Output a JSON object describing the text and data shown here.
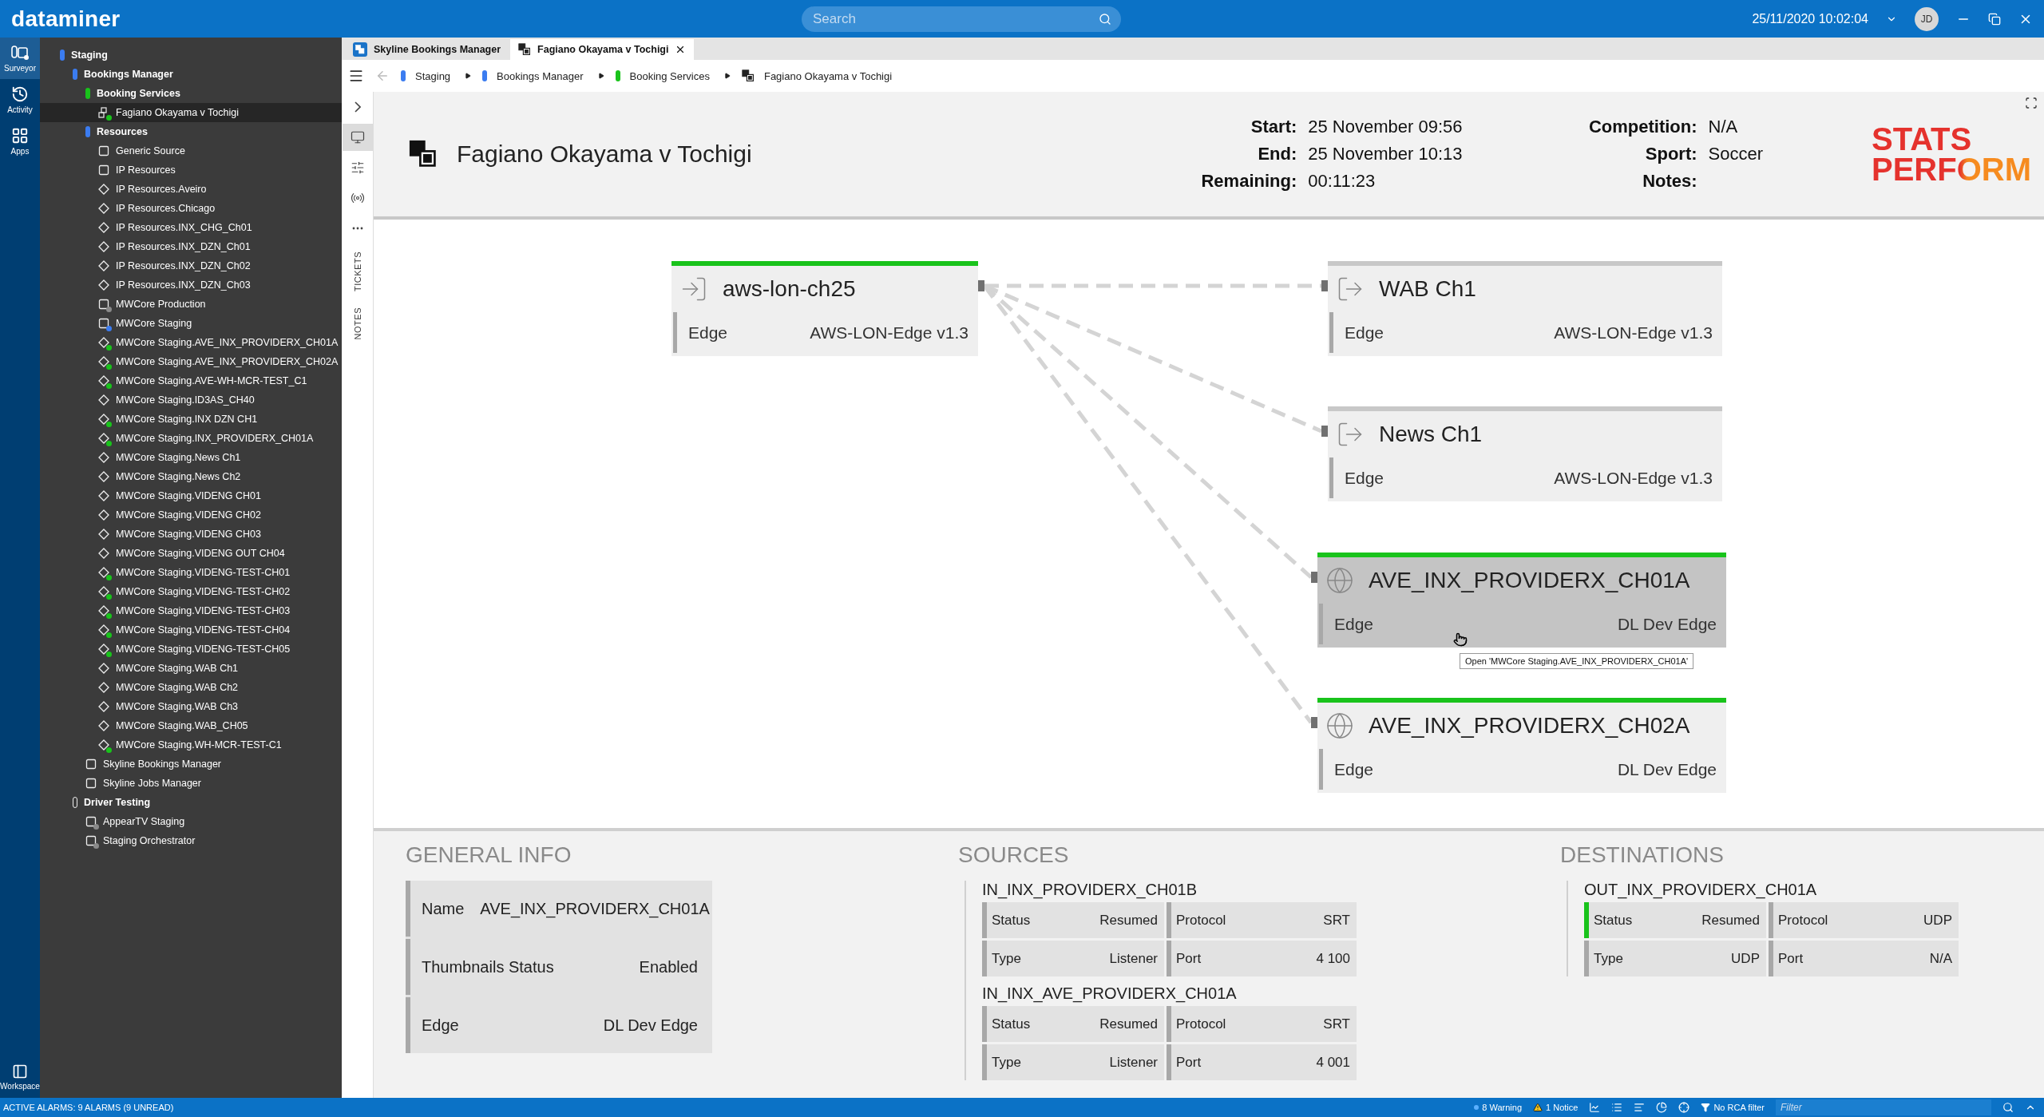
{
  "app": {
    "logo": "dataminer",
    "search_placeholder": "Search",
    "datetime": "25/11/2020 10:02:04",
    "user_initials": "JD"
  },
  "rail": {
    "items": [
      {
        "label": "Surveyor",
        "selected": true
      },
      {
        "label": "Activity",
        "selected": false
      },
      {
        "label": "Apps",
        "selected": false
      }
    ],
    "bottom_label": "Workspace"
  },
  "tree": [
    {
      "label": "Staging",
      "kind": "view",
      "color": "#3b7cf0",
      "selected": false,
      "children": [
        {
          "label": "Bookings Manager",
          "kind": "view",
          "color": "#3b7cf0",
          "selected": false,
          "children": [
            {
              "label": "Booking Services",
              "kind": "view",
              "color": "#19c31b",
              "selected": false,
              "children": [
                {
                  "label": "Fagiano Okayama v Tochigi",
                  "kind": "booking",
                  "color": "#19c31b",
                  "selected": true
                }
              ]
            },
            {
              "label": "Resources",
              "kind": "view",
              "color": "#3b7cf0",
              "selected": false,
              "children": [
                {
                  "label": "Generic Source",
                  "kind": "element",
                  "selected": false
                },
                {
                  "label": "IP Resources",
                  "kind": "element",
                  "selected": false
                },
                {
                  "label": "IP Resources.Aveiro",
                  "kind": "service",
                  "selected": false
                },
                {
                  "label": "IP Resources.Chicago",
                  "kind": "service",
                  "selected": false
                },
                {
                  "label": "IP Resources.INX_CHG_Ch01",
                  "kind": "service",
                  "selected": false
                },
                {
                  "label": "IP Resources.INX_DZN_Ch01",
                  "kind": "service",
                  "selected": false
                },
                {
                  "label": "IP Resources.INX_DZN_Ch02",
                  "kind": "service",
                  "selected": false
                },
                {
                  "label": "IP Resources.INX_DZN_Ch03",
                  "kind": "service",
                  "selected": false
                },
                {
                  "label": "MWCore Production",
                  "kind": "element",
                  "color": "#8a8a8a",
                  "selected": false
                },
                {
                  "label": "MWCore Staging",
                  "kind": "element",
                  "color": "#3b7cf0",
                  "selected": false
                },
                {
                  "label": "MWCore Staging.AVE_INX_PROVIDERX_CH01A",
                  "kind": "service",
                  "color": "#19c31b",
                  "selected": false
                },
                {
                  "label": "MWCore Staging.AVE_INX_PROVIDERX_CH02A",
                  "kind": "service",
                  "color": "#19c31b",
                  "selected": false
                },
                {
                  "label": "MWCore Staging.AVE-WH-MCR-TEST_C1",
                  "kind": "service",
                  "color": "#19c31b",
                  "selected": false
                },
                {
                  "label": "MWCore Staging.ID3AS_CH40",
                  "kind": "service",
                  "selected": false
                },
                {
                  "label": "MWCore Staging.INX DZN CH1",
                  "kind": "service",
                  "color": "#19c31b",
                  "selected": false
                },
                {
                  "label": "MWCore Staging.INX_PROVIDERX_CH01A",
                  "kind": "service",
                  "color": "#19c31b",
                  "selected": false
                },
                {
                  "label": "MWCore Staging.News Ch1",
                  "kind": "service",
                  "selected": false
                },
                {
                  "label": "MWCore Staging.News Ch2",
                  "kind": "service",
                  "selected": false
                },
                {
                  "label": "MWCore Staging.VIDENG CH01",
                  "kind": "service",
                  "selected": false
                },
                {
                  "label": "MWCore Staging.VIDENG CH02",
                  "kind": "service",
                  "selected": false
                },
                {
                  "label": "MWCore Staging.VIDENG CH03",
                  "kind": "service",
                  "selected": false
                },
                {
                  "label": "MWCore Staging.VIDENG OUT CH04",
                  "kind": "service",
                  "selected": false
                },
                {
                  "label": "MWCore Staging.VIDENG-TEST-CH01",
                  "kind": "service",
                  "color": "#19c31b",
                  "selected": false
                },
                {
                  "label": "MWCore Staging.VIDENG-TEST-CH02",
                  "kind": "service",
                  "color": "#19c31b",
                  "selected": false
                },
                {
                  "label": "MWCore Staging.VIDENG-TEST-CH03",
                  "kind": "service",
                  "color": "#19c31b",
                  "selected": false
                },
                {
                  "label": "MWCore Staging.VIDENG-TEST-CH04",
                  "kind": "service",
                  "color": "#19c31b",
                  "selected": false
                },
                {
                  "label": "MWCore Staging.VIDENG-TEST-CH05",
                  "kind": "service",
                  "color": "#19c31b",
                  "selected": false
                },
                {
                  "label": "MWCore Staging.WAB Ch1",
                  "kind": "service",
                  "selected": false
                },
                {
                  "label": "MWCore Staging.WAB Ch2",
                  "kind": "service",
                  "selected": false
                },
                {
                  "label": "MWCore Staging.WAB Ch3",
                  "kind": "service",
                  "selected": false
                },
                {
                  "label": "MWCore Staging.WAB_CH05",
                  "kind": "service",
                  "selected": false
                },
                {
                  "label": "MWCore Staging.WH-MCR-TEST-C1",
                  "kind": "service",
                  "color": "#19c31b",
                  "selected": false
                }
              ]
            },
            {
              "label": "Skyline Bookings Manager",
              "kind": "element",
              "selected": false
            },
            {
              "label": "Skyline Jobs Manager",
              "kind": "element",
              "selected": false
            }
          ]
        },
        {
          "label": "Driver Testing",
          "kind": "view",
          "selected": false,
          "children": [
            {
              "label": "AppearTV Staging",
              "kind": "element",
              "color": "#8a8a8a",
              "selected": false
            },
            {
              "label": "Staging Orchestrator",
              "kind": "element",
              "color": "#8a8a8a",
              "selected": false
            }
          ]
        }
      ]
    }
  ],
  "tabs": [
    {
      "label": "Skyline Bookings Manager",
      "kind": "app",
      "selected": false
    },
    {
      "label": "Fagiano Okayama v Tochigi",
      "kind": "booking",
      "selected": true
    }
  ],
  "breadcrumb": [
    {
      "label": "Staging",
      "kind": "view",
      "color": "#3b7cf0"
    },
    {
      "label": "Bookings Manager",
      "kind": "view",
      "color": "#3b7cf0"
    },
    {
      "label": "Booking Services",
      "kind": "view",
      "color": "#19c31b"
    },
    {
      "label": "Fagiano Okayama v Tochigi",
      "kind": "booking"
    }
  ],
  "side_tools": {
    "items": [
      {
        "selected": false
      },
      {
        "selected": true
      },
      {
        "selected": false
      },
      {
        "selected": false
      },
      {
        "selected": false
      }
    ],
    "panels": [
      "TICKETS",
      "NOTES"
    ]
  },
  "header": {
    "title": "Fagiano Okayama v Tochigi",
    "fields": [
      {
        "label": "Start:",
        "value": "25 November 09:56"
      },
      {
        "label": "End:",
        "value": "25 November 10:13"
      },
      {
        "label": "Remaining:",
        "value": "00:11:23"
      }
    ],
    "fields_2": [
      {
        "label": "Competition:",
        "value": "N/A"
      },
      {
        "label": "Sport:",
        "value": "Soccer"
      },
      {
        "label": "Notes:"
      }
    ],
    "logo": [
      "STATS",
      "PERFORM"
    ]
  },
  "diagram": {
    "nodes": [
      {
        "name": "aws-lon-ch25",
        "kind": "input",
        "label": "Edge",
        "value": "AWS-LON-Edge v1.3",
        "color": "#19c31b",
        "hovered": false
      },
      {
        "name": "WAB Ch1",
        "kind": "output",
        "label": "Edge",
        "value": "AWS-LON-Edge v1.3",
        "color": "#c8c8c8",
        "hovered": false
      },
      {
        "name": "News Ch1",
        "kind": "output",
        "label": "Edge",
        "value": "AWS-LON-Edge v1.3",
        "color": "#c8c8c8",
        "hovered": false
      },
      {
        "name": "AVE_INX_PROVIDERX_CH01A",
        "kind": "globe",
        "label": "Edge",
        "value": "DL Dev Edge",
        "color": "#19c31b",
        "hovered": true
      },
      {
        "name": "AVE_INX_PROVIDERX_CH02A",
        "kind": "globe",
        "label": "Edge",
        "value": "DL Dev Edge",
        "color": "#19c31b",
        "hovered": false
      }
    ],
    "tooltip": "Open 'MWCore Staging.AVE_INX_PROVIDERX_CH01A'"
  },
  "general_info": {
    "title": "GENERAL INFO",
    "rows": [
      {
        "label": "Name",
        "value": "AVE_INX_PROVIDERX_CH01A"
      },
      {
        "label": "Thumbnails Status",
        "value": "Enabled"
      },
      {
        "label": "Edge",
        "value": "DL Dev Edge"
      }
    ]
  },
  "sources": {
    "title": "SOURCES",
    "items": [
      {
        "name": "IN_INX_PROVIDERX_CH01B",
        "highlighted": false,
        "cells": [
          {
            "label": "Status",
            "value": "Resumed"
          },
          {
            "label": "Protocol",
            "value": "SRT"
          },
          {
            "label": "Type",
            "value": "Listener"
          },
          {
            "label": "Port",
            "value": "4 100"
          }
        ]
      },
      {
        "name": "IN_INX_AVE_PROVIDERX_CH01A",
        "highlighted": false,
        "cells": [
          {
            "label": "Status",
            "value": "Resumed"
          },
          {
            "label": "Protocol",
            "value": "SRT"
          },
          {
            "label": "Type",
            "value": "Listener"
          },
          {
            "label": "Port",
            "value": "4 001"
          }
        ]
      }
    ]
  },
  "destinations": {
    "title": "DESTINATIONS",
    "items": [
      {
        "name": "OUT_INX_PROVIDERX_CH01A",
        "highlighted": true,
        "cells": [
          {
            "label": "Status",
            "value": "Resumed"
          },
          {
            "label": "Protocol",
            "value": "UDP"
          },
          {
            "label": "Type",
            "value": "UDP"
          },
          {
            "label": "Port",
            "value": "N/A"
          }
        ]
      }
    ]
  },
  "status_bar": {
    "alarms": "ACTIVE ALARMS: 9 ALARMS (9 UNREAD)",
    "warning": "8 Warning",
    "notice": "1 Notice",
    "rca": "No RCA filter",
    "filter_placeholder": "Filter"
  }
}
